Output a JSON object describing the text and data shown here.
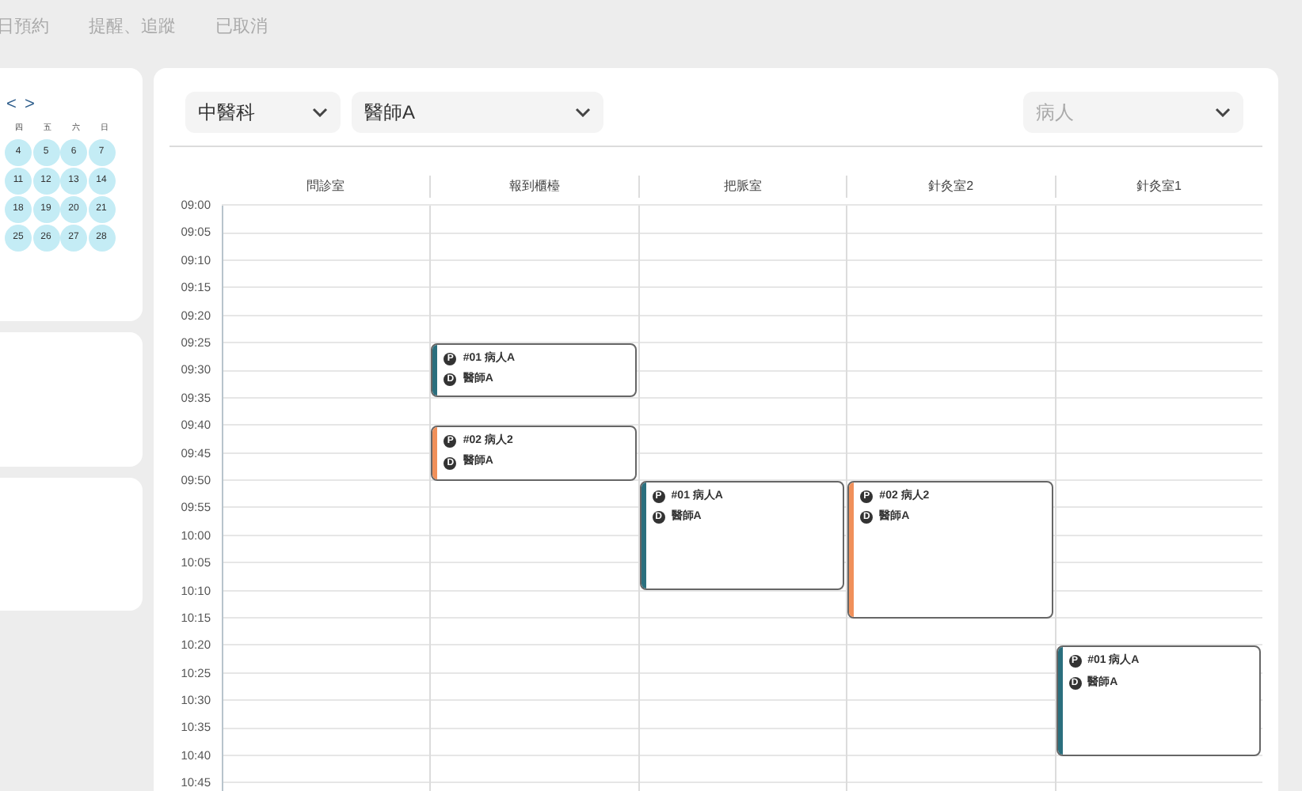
{
  "tabs": [
    {
      "label": "日預約",
      "selected": false
    },
    {
      "label": "提醒、追蹤",
      "selected": false
    },
    {
      "label": "已取消",
      "selected": false
    }
  ],
  "calendar": {
    "prev": "<",
    "next": ">",
    "weekdays": [
      "四",
      "五",
      "六",
      "日"
    ],
    "weeks": [
      [
        "4",
        "5",
        "6",
        "7"
      ],
      [
        "11",
        "12",
        "13",
        "14"
      ],
      [
        "18",
        "19",
        "20",
        "21"
      ],
      [
        "25",
        "26",
        "27",
        "28"
      ]
    ]
  },
  "filters": [
    {
      "value": "中醫科"
    },
    {
      "value": "醫師A"
    },
    {
      "placeholder": "病人"
    }
  ],
  "times": [
    "09:00",
    "09:05",
    "09:10",
    "09:15",
    "09:20",
    "09:25",
    "09:30",
    "09:35",
    "09:40",
    "09:45",
    "09:50",
    "09:55",
    "10:00",
    "10:05",
    "10:10",
    "10:15",
    "10:20",
    "10:25",
    "10:30",
    "10:35",
    "10:40",
    "10:45"
  ],
  "rooms": [
    {
      "label": "問診室"
    },
    {
      "label": "報到櫃檯",
      "slots": [
        {
          "kind": "free"
        },
        {
          "kind": "free"
        },
        {
          "kind": "free"
        },
        {
          "kind": "free"
        },
        {
          "kind": "free"
        },
        {
          "kind": "start",
          "color": "#2b6f7e",
          "patient_mark": "P",
          "patient": "#01 病人A",
          "doctor_mark": "D",
          "doctor": "醫師A"
        },
        {
          "kind": "cont"
        },
        {
          "kind": "free"
        },
        {
          "kind": "start",
          "color": "#f0905a",
          "patient_mark": "P",
          "patient": "#02 病人2",
          "doctor_mark": "D",
          "doctor": "醫師A"
        },
        {
          "kind": "cont"
        }
      ]
    },
    {
      "label": "把脈室",
      "slots": [
        {
          "kind": "free"
        },
        {
          "kind": "free"
        },
        {
          "kind": "free"
        },
        {
          "kind": "free"
        },
        {
          "kind": "free"
        },
        {
          "kind": "free"
        },
        {
          "kind": "free"
        },
        {
          "kind": "free"
        },
        {
          "kind": "free"
        },
        {
          "kind": "free"
        },
        {
          "kind": "start",
          "color": "#2b6f7e",
          "patient_mark": "P",
          "patient": "#01 病人A",
          "doctor_mark": "D",
          "doctor": "醫師A"
        },
        {
          "kind": "cont"
        },
        {
          "kind": "cont"
        },
        {
          "kind": "cont"
        }
      ]
    },
    {
      "label": "針灸室2",
      "slots": [
        {
          "kind": "free"
        },
        {
          "kind": "free"
        },
        {
          "kind": "free"
        },
        {
          "kind": "free"
        },
        {
          "kind": "free"
        },
        {
          "kind": "free"
        },
        {
          "kind": "free"
        },
        {
          "kind": "free"
        },
        {
          "kind": "free"
        },
        {
          "kind": "free"
        },
        {
          "kind": "start",
          "color": "#f0905a",
          "patient_mark": "P",
          "patient": "#02 病人2",
          "doctor_mark": "D",
          "doctor": "醫師A"
        },
        {
          "kind": "cont"
        },
        {
          "kind": "cont"
        },
        {
          "kind": "cont"
        },
        {
          "kind": "cont"
        }
      ]
    },
    {
      "label": "針灸室1",
      "slots": [
        {
          "kind": "free"
        },
        {
          "kind": "free"
        },
        {
          "kind": "free"
        },
        {
          "kind": "free"
        },
        {
          "kind": "free"
        },
        {
          "kind": "free"
        },
        {
          "kind": "free"
        },
        {
          "kind": "free"
        },
        {
          "kind": "free"
        },
        {
          "kind": "free"
        },
        {
          "kind": "free"
        },
        {
          "kind": "free"
        },
        {
          "kind": "free"
        },
        {
          "kind": "free"
        },
        {
          "kind": "free"
        },
        {
          "kind": "free"
        },
        {
          "kind": "start",
          "color": "#2b6f7e",
          "patient_mark": "P",
          "patient": "#01 病人A",
          "doctor_mark": "D",
          "doctor": "醫師A"
        },
        {
          "kind": "cont"
        },
        {
          "kind": "cont"
        },
        {
          "kind": "cont"
        }
      ]
    }
  ]
}
